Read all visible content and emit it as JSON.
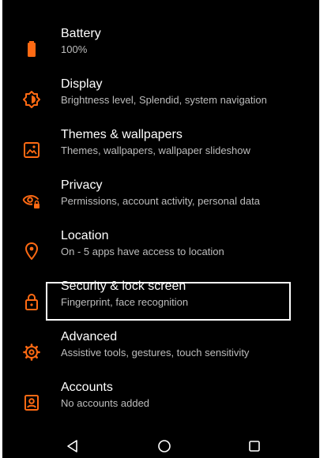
{
  "colors": {
    "accent": "#ff6a13",
    "background": "#000000",
    "title": "#ffffff",
    "subtitle": "#bdbdbd"
  },
  "settings": {
    "items": [
      {
        "icon": "battery-icon",
        "title": "Battery",
        "subtitle": "100%"
      },
      {
        "icon": "display-brightness-icon",
        "title": "Display",
        "subtitle": "Brightness level, Splendid, system navigation"
      },
      {
        "icon": "wallpaper-icon",
        "title": "Themes & wallpapers",
        "subtitle": "Themes, wallpapers, wallpaper slideshow"
      },
      {
        "icon": "privacy-eye-lock-icon",
        "title": "Privacy",
        "subtitle": "Permissions, account activity, personal data"
      },
      {
        "icon": "location-pin-icon",
        "title": "Location",
        "subtitle": "On - 5 apps have access to location"
      },
      {
        "icon": "lock-icon",
        "title": "Security & lock screen",
        "subtitle": "Fingerprint, face recognition"
      },
      {
        "icon": "advanced-gear-icon",
        "title": "Advanced",
        "subtitle": "Assistive tools, gestures, touch sensitivity"
      },
      {
        "icon": "account-box-icon",
        "title": "Accounts",
        "subtitle": "No accounts added"
      }
    ]
  },
  "navbar": {
    "back": "back-triangle-icon",
    "home": "home-circle-icon",
    "recents": "recents-square-icon"
  }
}
